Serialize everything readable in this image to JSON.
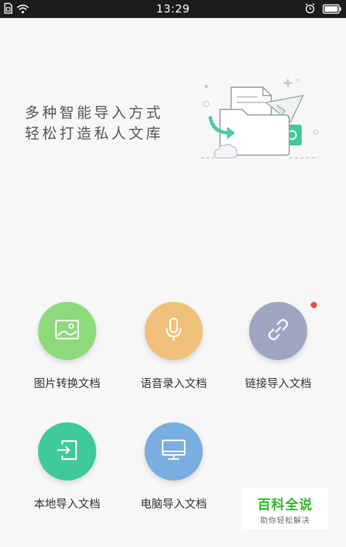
{
  "status_bar": {
    "time": "13:29",
    "left_icons": [
      "sim-card-icon",
      "wifi-icon"
    ],
    "right_icons": [
      "alarm-icon",
      "battery-icon"
    ]
  },
  "banner": {
    "line1": "多种智能导入方式",
    "line2": "轻松打造私人文库"
  },
  "features": [
    {
      "label": "图片转换文档",
      "icon": "image-icon",
      "color": "#8ed97c"
    },
    {
      "label": "语音录入文档",
      "icon": "microphone-icon",
      "color": "#efc17a"
    },
    {
      "label": "链接导入文档",
      "icon": "link-icon",
      "color": "#9fa6c2",
      "has_new_badge": true
    },
    {
      "label": "本地导入文档",
      "icon": "import-icon",
      "color": "#3fca9c"
    },
    {
      "label": "电脑导入文档",
      "icon": "monitor-icon",
      "color": "#7aaee0"
    }
  ],
  "watermark": {
    "title": "百科全说",
    "subtitle": "助你轻松解决"
  }
}
